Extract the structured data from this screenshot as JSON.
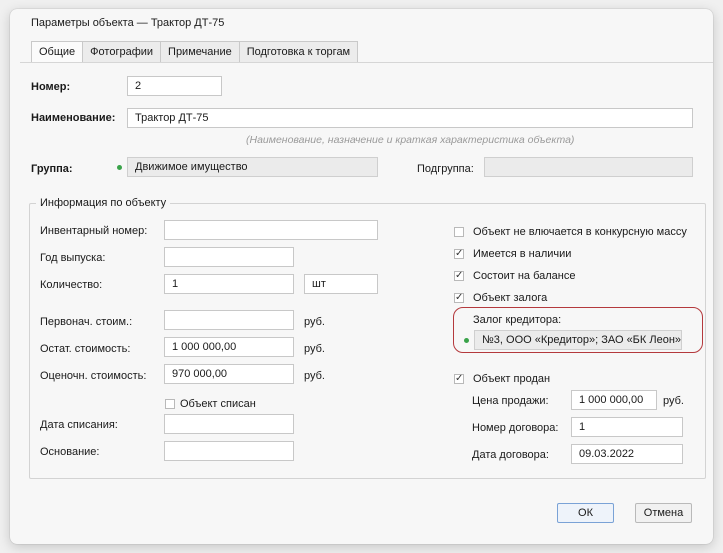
{
  "window": {
    "title": "Параметры объекта — Трактор ДТ-75"
  },
  "tabs": [
    "Общие",
    "Фотографии",
    "Примечание",
    "Подготовка к торгам"
  ],
  "header": {
    "number_label": "Номер:",
    "number_value": "2",
    "name_label": "Наименование:",
    "name_value": "Трактор ДТ-75",
    "name_hint": "(Наименование, назначение и краткая характеристика объекта)",
    "group_label": "Группа:",
    "group_value": "Движимое имущество",
    "subgroup_label": "Подгруппа:",
    "subgroup_value": ""
  },
  "info": {
    "legend": "Информация по объекту",
    "inventory_label": "Инвентарный номер:",
    "inventory_value": "",
    "year_label": "Год выпуска:",
    "year_value": "",
    "qty_label": "Количество:",
    "qty_value": "1",
    "qty_unit": "шт",
    "initial_cost_label": "Первонач. стоим.:",
    "initial_cost_value": "",
    "initial_cost_unit": "руб.",
    "residual_cost_label": "Остат. стоимость:",
    "residual_cost_value": "1 000 000,00",
    "residual_cost_unit": "руб.",
    "appraised_cost_label": "Оценочн. стоимость:",
    "appraised_cost_value": "970 000,00",
    "appraised_cost_unit": "руб.",
    "written_off_label": "Объект списан",
    "writeoff_date_label": "Дата списания:",
    "writeoff_date_value": "",
    "basis_label": "Основание:",
    "basis_value": ""
  },
  "flags": {
    "not_included_label": "Объект не влючается в конкурсную массу",
    "not_included_checked": false,
    "available_label": "Имеется в наличии",
    "available_checked": true,
    "on_balance_label": "Состоит на балансе",
    "on_balance_checked": true,
    "pledge_label": "Объект залога",
    "pledge_checked": true,
    "creditor_label": "Залог кредитора:",
    "creditor_value": "№3, ООО «Кредитор»; ЗАО «БК Леон»",
    "sold_label": "Объект продан",
    "sold_checked": true,
    "sale_price_label": "Цена продажи:",
    "sale_price_value": "1 000 000,00",
    "sale_price_unit": "руб.",
    "contract_no_label": "Номер договора:",
    "contract_no_value": "1",
    "contract_date_label": "Дата договора:",
    "contract_date_value": "09.03.2022"
  },
  "buttons": {
    "ok": "ОК",
    "cancel": "Отмена"
  },
  "glyphs": {
    "check": "✓"
  },
  "colors": {
    "status_dot": "#3aa34a",
    "highlight_border": "#b4393d",
    "ok_border": "#7aa2d6"
  }
}
